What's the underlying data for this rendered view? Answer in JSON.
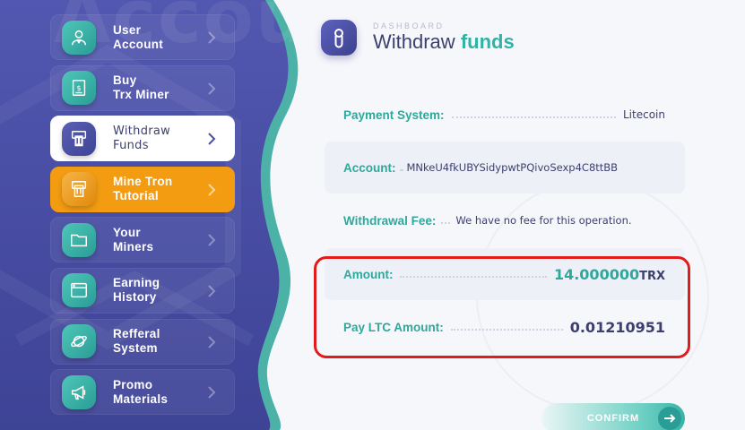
{
  "sidebar": {
    "watermark": "Account",
    "items": [
      {
        "label": "User\nAccount",
        "icon": "user-icon",
        "state": "normal"
      },
      {
        "label": "Buy\nTrx Miner",
        "icon": "receipt-dollar-icon",
        "state": "normal"
      },
      {
        "label": "Withdraw\nFunds",
        "icon": "atm-withdraw-icon",
        "state": "active"
      },
      {
        "label": "Mine Tron\nTutorial",
        "icon": "atm-withdraw-icon",
        "state": "highlight"
      },
      {
        "label": "Your\nMiners",
        "icon": "folder-icon",
        "state": "normal"
      },
      {
        "label": "Earning\nHistory",
        "icon": "browser-window-icon",
        "state": "normal"
      },
      {
        "label": "Refferal\nSystem",
        "icon": "planet-icon",
        "state": "normal"
      },
      {
        "label": "Promo\nMaterials",
        "icon": "megaphone-icon",
        "state": "normal"
      }
    ]
  },
  "header": {
    "eyebrow": "DASHBOARD",
    "title_main": "Withdraw",
    "title_accent": "funds",
    "icon": "figure-eight-icon"
  },
  "fields": {
    "payment_system": {
      "label": "Payment System:",
      "value": "Litecoin"
    },
    "account": {
      "label": "Account:",
      "value": "MNkeU4fkUBYSidypwtPQivoSexp4C8ttBB"
    },
    "withdrawal_fee": {
      "label": "Withdrawal Fee:",
      "value": "We have no fee for this operation."
    },
    "amount": {
      "label": "Amount:",
      "value": "14.000000",
      "unit": "TRX"
    },
    "pay_amount": {
      "label": "Pay LTC Amount:",
      "value": "0.01210951"
    }
  },
  "confirm_label": "CONFIRM",
  "colors": {
    "sidebar_bg": "#4b4fa6",
    "accent_teal": "#2fb3a5",
    "highlight_orange": "#f39c12",
    "annotation_red": "#e21b1b"
  }
}
